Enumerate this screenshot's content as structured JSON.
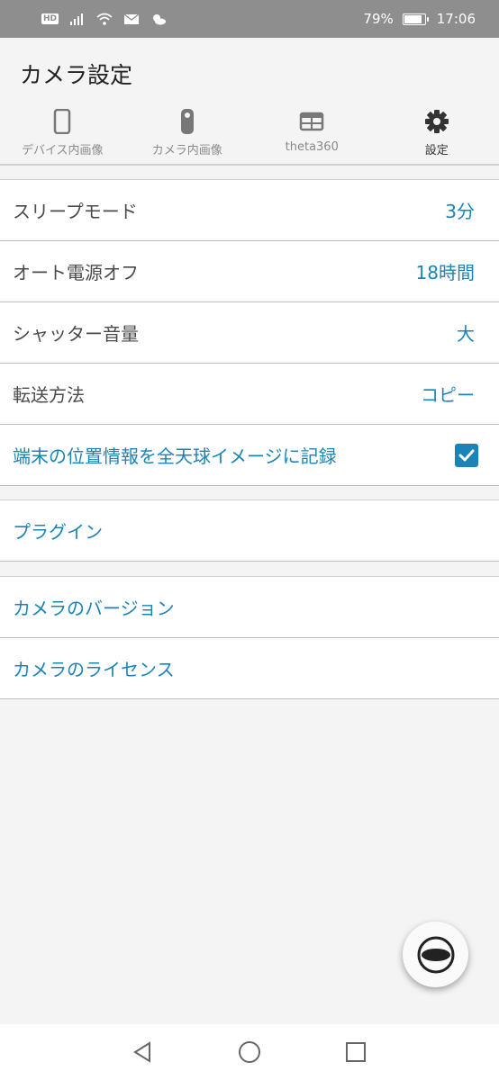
{
  "status_bar": {
    "hd": "HD",
    "battery_percent_text": "79%",
    "battery_level": 0.79,
    "time": "17:06"
  },
  "header": {
    "title": "カメラ設定",
    "tabs": [
      {
        "label": "デバイス内画像",
        "icon": "phone-icon"
      },
      {
        "label": "カメラ内画像",
        "icon": "camera-icon"
      },
      {
        "label": "theta360",
        "icon": "browser-window-icon"
      },
      {
        "label": "設定",
        "icon": "gear-icon",
        "active": true
      }
    ]
  },
  "settings": {
    "sleep_mode": {
      "label": "スリープモード",
      "value": "3分"
    },
    "auto_power_off": {
      "label": "オート電源オフ",
      "value": "18時間"
    },
    "shutter_volume": {
      "label": "シャッター音量",
      "value": "大"
    },
    "transfer_method": {
      "label": "転送方法",
      "value": "コピー"
    },
    "location_record": {
      "label": "端末の位置情報を全天球イメージに記録",
      "checked": true
    }
  },
  "plugins": {
    "label": "プラグイン"
  },
  "about": {
    "camera_version": "カメラのバージョン",
    "camera_license": "カメラのライセンス"
  },
  "colors": {
    "accent": "#1a84b8",
    "status_bar": "#8e8e8e",
    "background": "#f4f4f4"
  }
}
